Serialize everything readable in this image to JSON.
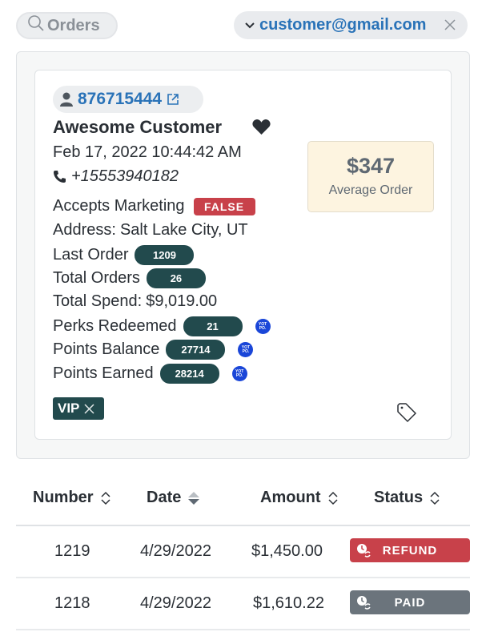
{
  "topbar": {
    "search_label": "Orders",
    "search_icon": "search-icon",
    "customer_email": "customer@gmail.com",
    "chevron_icon": "chevron-down-icon",
    "close_icon": "close-icon"
  },
  "customer": {
    "id": "876715444",
    "name": "Awesome Customer",
    "created": "Feb 17, 2022 10:44:42 AM",
    "phone": "+15553940182",
    "average_order": {
      "value": "$347",
      "label": "Average Order"
    },
    "fields": {
      "accepts_marketing": {
        "label": "Accepts Marketing",
        "value": "FALSE"
      },
      "address": {
        "label": "Address:",
        "value": "Salt Lake City, UT"
      },
      "last_order": {
        "label": "Last Order",
        "value": "1209"
      },
      "total_orders": {
        "label": "Total Orders",
        "value": "26"
      },
      "total_spend": {
        "label": "Total Spend:",
        "value": "$9,019.00"
      },
      "perks_redeemed": {
        "label": "Perks Redeemed",
        "value": "21"
      },
      "points_balance": {
        "label": "Points Balance",
        "value": "27714"
      },
      "points_earned": {
        "label": "Points Earned",
        "value": "28214"
      }
    },
    "yotpo_label": "YOT PO.",
    "tags": [
      {
        "label": "VIP"
      }
    ]
  },
  "orders_table": {
    "columns": [
      "Number",
      "Date",
      "Amount",
      "Status"
    ],
    "rows": [
      {
        "number": "1219",
        "date": "4/29/2022",
        "amount": "$1,450.00",
        "status": "REFUND",
        "status_color": "#c8414a"
      },
      {
        "number": "1218",
        "date": "4/29/2022",
        "amount": "$1,610.22",
        "status": "PAID",
        "status_color": "#6b747c"
      }
    ]
  },
  "colors": {
    "link_blue": "#2a73b8",
    "dark_teal": "#224a4d",
    "danger_red": "#c8414a",
    "paid_gray": "#6b747c",
    "yotpo_blue": "#1a46d8",
    "avg_bg": "#fdf4e0"
  }
}
